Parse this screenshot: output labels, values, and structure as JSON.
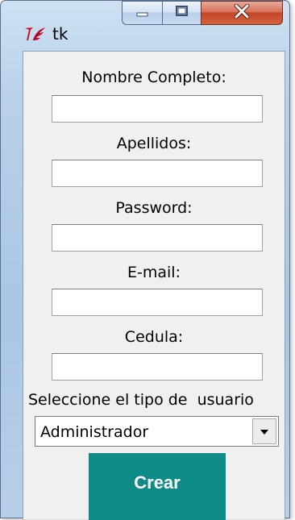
{
  "window": {
    "title": "tk",
    "icon": "tk-feather-icon",
    "buttons": [
      "minimize-icon",
      "maximize-icon",
      "close-icon"
    ]
  },
  "form": {
    "fields": [
      {
        "label": "Nombre Completo:",
        "value": ""
      },
      {
        "label": "Apellidos:",
        "value": ""
      },
      {
        "label": "Password:",
        "value": ""
      },
      {
        "label": "E-mail:",
        "value": ""
      },
      {
        "label": "Cedula:",
        "value": ""
      }
    ],
    "user_type_label": "Seleccione el tipo de  usuario",
    "user_type_value": "Administrador",
    "create_label": "Crear"
  },
  "colors": {
    "button_bg": "#0e8b86",
    "button_text": "#ffffff",
    "client_bg": "#f0f0f0"
  }
}
